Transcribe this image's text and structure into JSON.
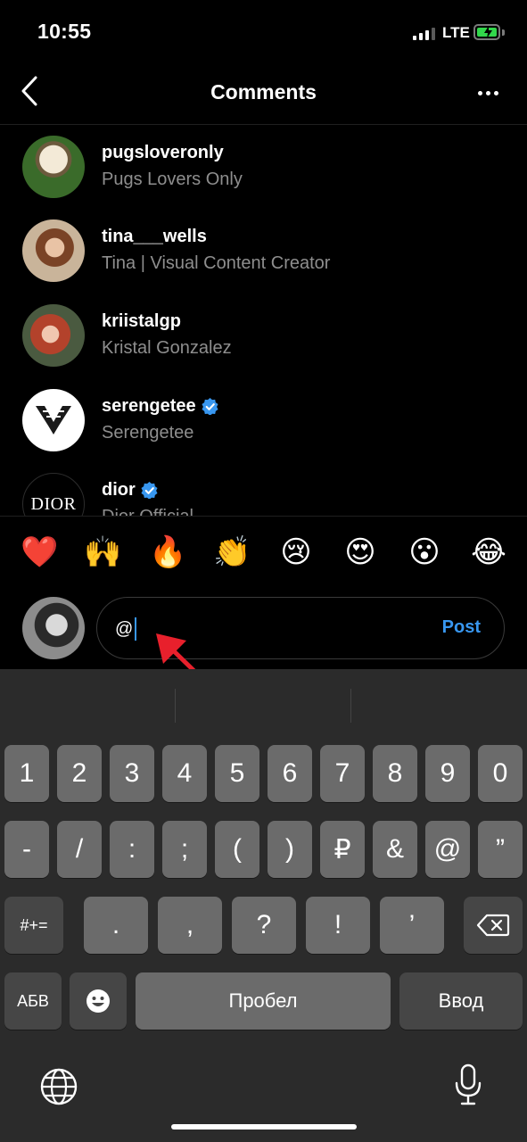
{
  "status_bar": {
    "time": "10:55",
    "network": "LTE",
    "battery_icon": "battery-charging-icon",
    "signal_icon": "signal-bars-icon"
  },
  "header": {
    "title": "Comments",
    "back_icon": "chevron-left-icon",
    "more_icon": "more-horizontal-icon"
  },
  "suggestions": [
    {
      "username": "pugsloveronly",
      "full_name": "Pugs Lovers Only",
      "verified": false
    },
    {
      "username": "tina___wells",
      "full_name": "Tina | Visual Content Creator",
      "verified": false
    },
    {
      "username": "kriistalgp",
      "full_name": "Kristal Gonzalez",
      "verified": false
    },
    {
      "username": "serengetee",
      "full_name": "Serengetee",
      "verified": true
    },
    {
      "username": "dior",
      "full_name": "Dior Official",
      "verified": true,
      "avatar_text": "DIOR"
    }
  ],
  "emoji_bar": [
    "❤️",
    "🙌",
    "🔥",
    "👏",
    "😢",
    "😍",
    "😮",
    "😂"
  ],
  "comment_input": {
    "value": "@",
    "post_label": "Post"
  },
  "keyboard": {
    "row1": [
      "1",
      "2",
      "3",
      "4",
      "5",
      "6",
      "7",
      "8",
      "9",
      "0"
    ],
    "row2": [
      "-",
      "/",
      ":",
      ";",
      "(",
      ")",
      "₽",
      "&",
      "@",
      "”"
    ],
    "row3": [
      ".",
      ",",
      "?",
      "!",
      "’"
    ],
    "shift_label": "#+=",
    "alpha_label": "АБВ",
    "space_label": "Пробел",
    "return_label": "Ввод",
    "emoji_icon": "emoji-face-icon",
    "globe_icon": "globe-icon",
    "mic_icon": "microphone-icon",
    "delete_icon": "backspace-icon"
  },
  "colors": {
    "accent": "#3897f0",
    "background": "#000000",
    "secondary_text": "#8e8e8e",
    "annotation_arrow": "#e8202c"
  }
}
